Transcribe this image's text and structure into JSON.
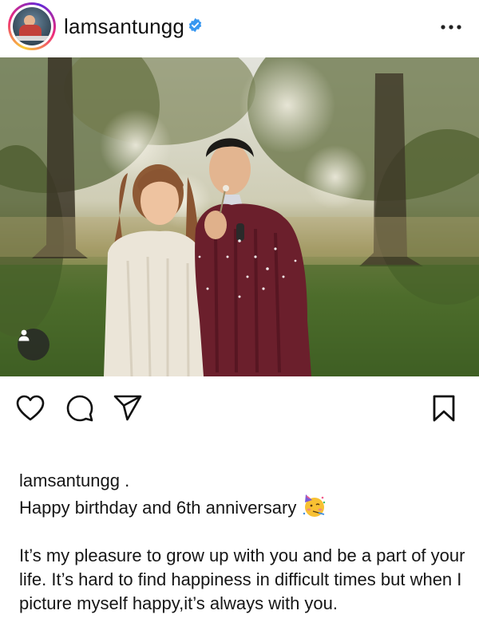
{
  "header": {
    "username": "lamsantungg",
    "more_icon": "more-horizontal-icon",
    "verified_icon": "verified-badge-icon"
  },
  "post": {
    "tag_icon": "user-tag-icon"
  },
  "actions": {
    "like_icon": "heart-icon",
    "comment_icon": "comment-bubble-icon",
    "share_icon": "paper-plane-icon",
    "save_icon": "bookmark-icon"
  },
  "caption": {
    "username": "lamsantungg .",
    "line1": "Happy birthday and 6th anniversary",
    "emoji_icon": "partying-face-icon",
    "body": "It’s my pleasure to grow up with you and be a part of your life. It’s hard to find happiness in difficult times but when I picture myself happy,it’s always with you."
  },
  "colors": {
    "verified_blue": "#3897f0",
    "text": "#161616",
    "sweater_burgundy": "#6b1f2c",
    "sweater_cream": "#ece6da"
  }
}
